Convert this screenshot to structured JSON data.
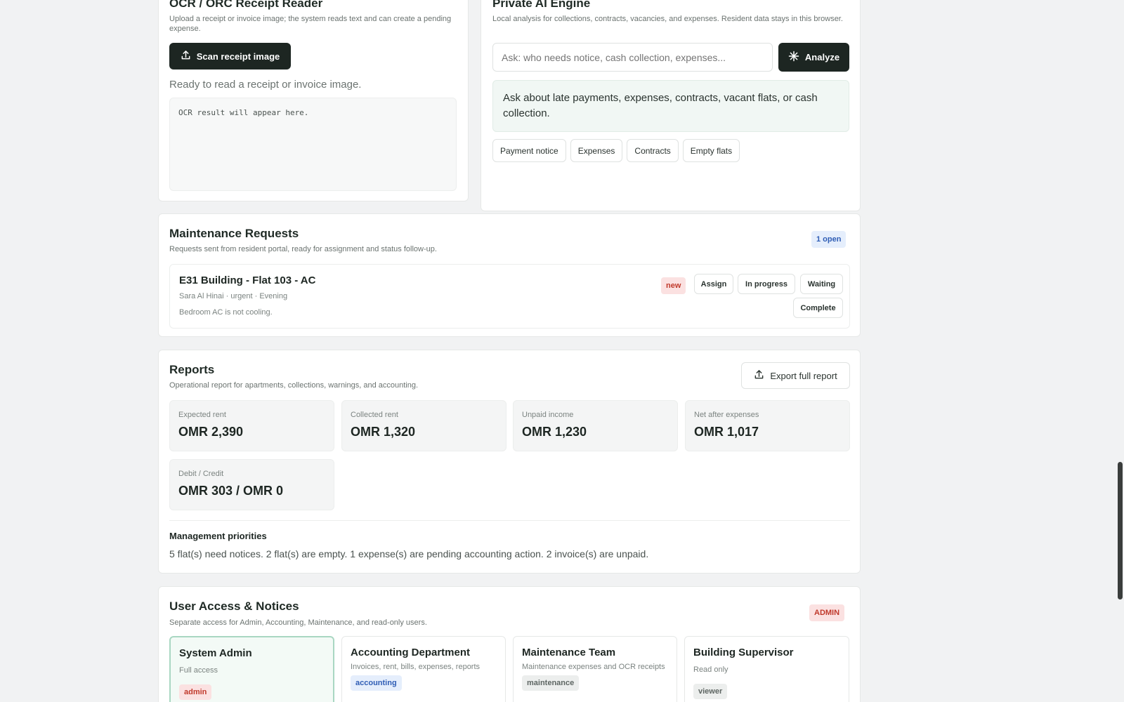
{
  "ocr": {
    "title": "OCR / ORC Receipt Reader",
    "subtitle": "Upload a receipt or invoice image; the system reads text and can create a pending expense.",
    "scan_button": "Scan receipt image",
    "status": "Ready to read a receipt or invoice image.",
    "result_placeholder": "OCR result will appear here."
  },
  "ai": {
    "title": "Private AI Engine",
    "subtitle": "Local analysis for collections, contracts, vacancies, and expenses. Resident data stays in this browser.",
    "input_placeholder": "Ask: who needs notice, cash collection, expenses...",
    "analyze_button": "Analyze",
    "hint": "Ask about late payments, expenses, contracts, vacant flats, or cash collection.",
    "chips": [
      "Payment notice",
      "Expenses",
      "Contracts",
      "Empty flats"
    ]
  },
  "maintenance": {
    "title": "Maintenance Requests",
    "subtitle": "Requests sent from resident portal, ready for assignment and status follow-up.",
    "open_badge": "1 open",
    "request": {
      "title": "E31 Building - Flat 103 - AC",
      "meta": "Sara Al Hinai · urgent · Evening",
      "description": "Bedroom AC is not cooling.",
      "status": "new",
      "actions": [
        "Assign",
        "In progress",
        "Waiting",
        "Complete"
      ]
    }
  },
  "reports": {
    "title": "Reports",
    "subtitle": "Operational report for apartments, collections, warnings, and accounting.",
    "export_button": "Export full report",
    "stats": [
      {
        "label": "Expected rent",
        "value": "OMR 2,390"
      },
      {
        "label": "Collected rent",
        "value": "OMR 1,320"
      },
      {
        "label": "Unpaid income",
        "value": "OMR 1,230"
      },
      {
        "label": "Net after expenses",
        "value": "OMR 1,017"
      },
      {
        "label": "Debit / Credit",
        "value": "OMR 303 / OMR 0"
      }
    ],
    "priorities_title": "Management priorities",
    "priorities_text": "5 flat(s) need notices. 2 flat(s) are empty. 1 expense(s) are pending accounting action. 2 invoice(s) are unpaid."
  },
  "access": {
    "title": "User Access & Notices",
    "subtitle": "Separate access for Admin, Accounting, Maintenance, and read-only users.",
    "role_badge": "ADMIN",
    "roles": [
      {
        "name": "System Admin",
        "desc": "Full access",
        "badge": "admin"
      },
      {
        "name": "Accounting Department",
        "desc": "Invoices, rent, bills, expenses, reports",
        "badge": "accounting"
      },
      {
        "name": "Maintenance Team",
        "desc": "Maintenance expenses and OCR receipts",
        "badge": "maintenance"
      },
      {
        "name": "Building Supervisor",
        "desc": "Read only",
        "badge": "viewer"
      }
    ]
  },
  "icons": {
    "upload": "upload-icon",
    "spark": "spark-icon",
    "export": "export-icon"
  },
  "colors": {
    "dark_button": "#1d2622",
    "accent_green": "#a9d7c2",
    "danger": "#c0392b",
    "info": "#2f5db5"
  }
}
